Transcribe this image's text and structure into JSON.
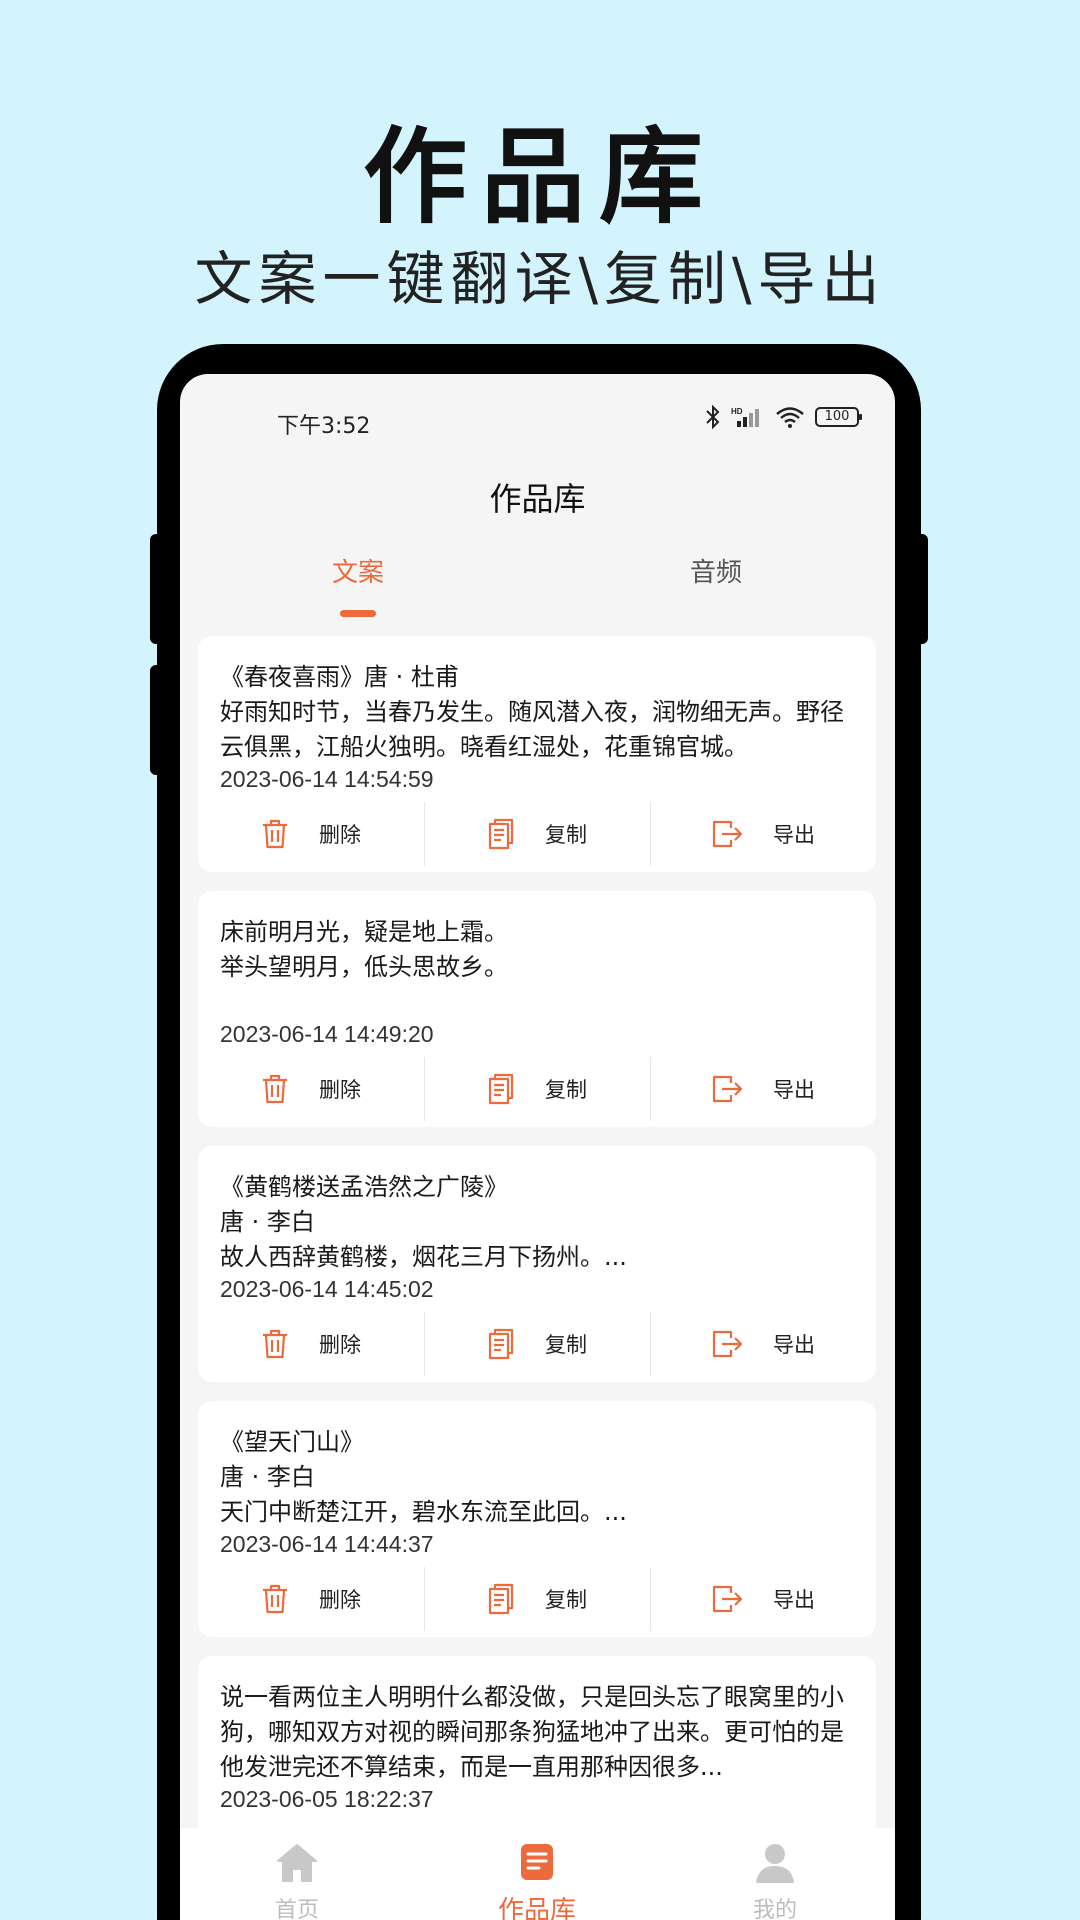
{
  "promo": {
    "title": "作品库",
    "subtitle": "文案一键翻译\\复制\\导出"
  },
  "status_bar": {
    "time": "下午3:52",
    "battery": "100",
    "icons": [
      "bluetooth-icon",
      "signal-hd-icon",
      "wifi-icon",
      "battery-icon"
    ]
  },
  "header": {
    "title": "作品库"
  },
  "tabs": [
    {
      "label": "文案",
      "active": true
    },
    {
      "label": "音频",
      "active": false
    }
  ],
  "actions": {
    "delete_label": "删除",
    "copy_label": "复制",
    "export_label": "导出"
  },
  "cards": [
    {
      "text": "《春夜喜雨》唐 · 杜甫\n好雨知时节，当春乃发生。随风潜入夜，润物细无声。野径云俱黑，江船火独明。晓看红湿处，花重锦官城。",
      "time": "2023-06-14 14:54:59"
    },
    {
      "text": "床前明月光，疑是地上霜。\n举头望明月，低头思故乡。",
      "time": "2023-06-14 14:49:20"
    },
    {
      "text": "《黄鹤楼送孟浩然之广陵》\n唐 · 李白\n故人西辞黄鹤楼，烟花三月下扬州。...",
      "time": "2023-06-14 14:45:02"
    },
    {
      "text": "《望天门山》\n唐 · 李白\n天门中断楚江开，碧水东流至此回。...",
      "time": "2023-06-14 14:44:37"
    },
    {
      "text": "说一看两位主人明明什么都没做，只是回头忘了眼窝里的小狗，哪知双方对视的瞬间那条狗猛地冲了出来。更可怕的是他发泄完还不算结束，而是一直用那种因很多...",
      "time": "2023-06-05 18:22:37"
    }
  ],
  "bottom_nav": [
    {
      "label": "首页",
      "icon": "home-icon",
      "active": false
    },
    {
      "label": "作品库",
      "icon": "document-icon",
      "active": true
    },
    {
      "label": "我的",
      "icon": "user-icon",
      "active": false
    }
  ],
  "colors": {
    "accent": "#ec6a3c",
    "background": "#d3f4fc"
  }
}
